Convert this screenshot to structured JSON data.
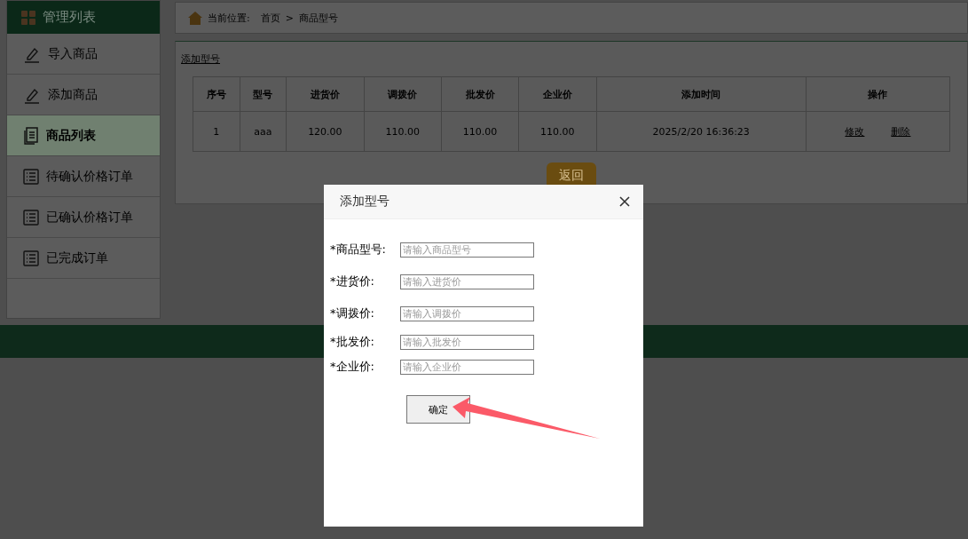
{
  "sidebar": {
    "title": "管理列表",
    "items": [
      {
        "label": "导入商品",
        "kind": "edit",
        "selected": false
      },
      {
        "label": "添加商品",
        "kind": "edit",
        "selected": false
      },
      {
        "label": "商品列表",
        "kind": "catalog",
        "selected": true
      },
      {
        "label": "待确认价格订单",
        "kind": "orders",
        "selected": false
      },
      {
        "label": "已确认价格订单",
        "kind": "orders",
        "selected": false
      },
      {
        "label": "已完成订单",
        "kind": "orders",
        "selected": false
      }
    ]
  },
  "breadcrumb": {
    "label": "当前位置:",
    "items": [
      "首页",
      ">",
      "商品型号"
    ]
  },
  "add_link": "添加型号",
  "table": {
    "columns": [
      "序号",
      "型号",
      "进货价",
      "调拨价",
      "批发价",
      "企业价",
      "添加时间",
      "操作"
    ],
    "rows": [
      {
        "cells": [
          "1",
          "aaa",
          "120.00",
          "110.00",
          "110.00",
          "110.00",
          "2025/2/20 16:36:23"
        ],
        "actions": [
          "修改",
          "删除"
        ]
      }
    ]
  },
  "back_button": "返回",
  "dialog": {
    "title": "添加型号",
    "fields": [
      {
        "label": "*商品型号:",
        "placeholder": "请输入商品型号"
      },
      {
        "label": "*进货价:",
        "placeholder": "请输入进货价"
      },
      {
        "label": "*调拨价:",
        "placeholder": "请输入调拨价"
      },
      {
        "label": "*批发价:",
        "placeholder": "请输入批发价"
      },
      {
        "label": "*企业价:",
        "placeholder": "请输入企业价"
      }
    ],
    "confirm": "确定"
  }
}
